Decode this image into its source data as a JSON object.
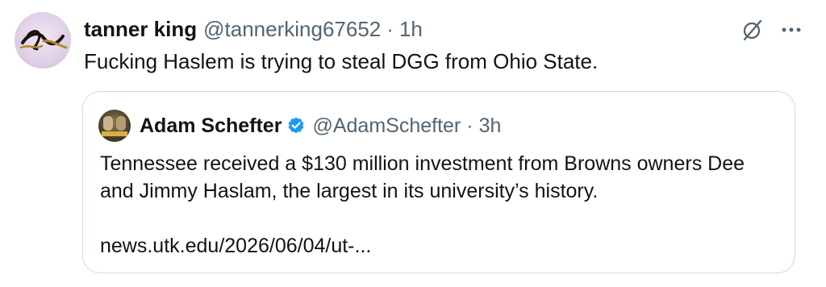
{
  "tweet": {
    "author_name": "tanner king",
    "author_handle": "@tannerking67652",
    "separator": "·",
    "time": "1h",
    "text": "Fucking Haslem is trying to steal DGG from Ohio State."
  },
  "quoted_tweet": {
    "author_name": "Adam Schefter",
    "author_handle": "@AdamSchefter",
    "separator": "·",
    "time": "3h",
    "text_line1": "Tennessee received a $130 million investment from Browns owners Dee",
    "text_line2": "and Jimmy Haslam, the largest in its university’s history.",
    "link": "news.utk.edu/2026/06/04/ut-..."
  },
  "icons": {
    "grok": "grok-icon",
    "more": "more-icon",
    "verified": "verified-badge-icon"
  },
  "colors": {
    "text_primary": "#0f1419",
    "text_secondary": "#536471",
    "border": "#cfd9de",
    "verified_blue": "#1d9bf0"
  }
}
